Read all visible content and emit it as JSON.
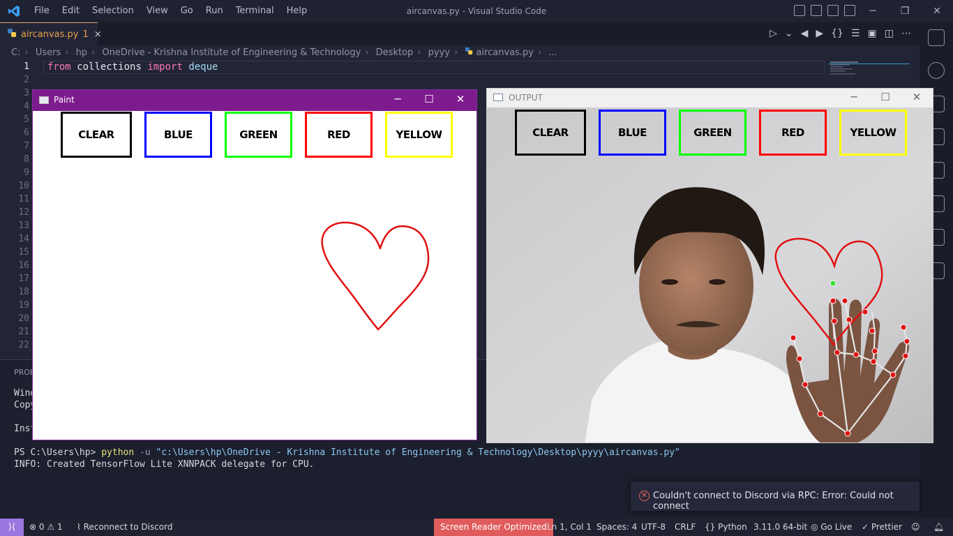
{
  "titlebar": {
    "menu": [
      "File",
      "Edit",
      "Selection",
      "View",
      "Go",
      "Run",
      "Terminal",
      "Help"
    ],
    "title": "aircanvas.py - Visual Studio Code"
  },
  "tab": {
    "filename": "aircanvas.py",
    "badge": "1",
    "close": "×"
  },
  "breadcrumb": [
    "C:",
    "Users",
    "hp",
    "OneDrive - Krishna Institute of Engineering & Technology",
    "Desktop",
    "pyyy",
    "aircanvas.py",
    "..."
  ],
  "editor": {
    "line_numbers": [
      "1",
      "2",
      "3",
      "4",
      "5",
      "6",
      "7",
      "8",
      "9",
      "10",
      "11",
      "12",
      "13",
      "14",
      "15",
      "16",
      "17",
      "18",
      "19",
      "20",
      "21",
      "22"
    ],
    "code_line1": {
      "kw1": "from",
      "mod": "collections",
      "kw2": "import",
      "name": "deque"
    }
  },
  "panel": {
    "title": "PROB",
    "partial_lines": [
      "Wind",
      "Copy",
      "",
      "Inst"
    ],
    "prompt": "PS C:\\Users\\hp>",
    "cmd": "python",
    "flag": "-u",
    "path": "\"c:\\Users\\hp\\OneDrive - Krishna Institute of Engineering & Technology\\Desktop\\pyyy\\aircanvas.py\"",
    "info": "INFO: Created TensorFlow Lite XNNPACK delegate for CPU."
  },
  "paint_window": {
    "title": "Paint",
    "buttons": [
      {
        "label": "CLEAR",
        "color": "#000000"
      },
      {
        "label": "BLUE",
        "color": "#0000ff"
      },
      {
        "label": "GREEN",
        "color": "#00ff00"
      },
      {
        "label": "RED",
        "color": "#ff0000"
      },
      {
        "label": "YELLOW",
        "color": "#ffff00"
      }
    ],
    "stroke_color": "#ff0000"
  },
  "output_window": {
    "title": "OUTPUT",
    "buttons": [
      {
        "label": "CLEAR",
        "color": "#000000"
      },
      {
        "label": "BLUE",
        "color": "#0000ff"
      },
      {
        "label": "GREEN",
        "color": "#00ff00"
      },
      {
        "label": "RED",
        "color": "#ff0000"
      },
      {
        "label": "YELLOW",
        "color": "#ffff00"
      }
    ]
  },
  "notification": {
    "message": "Couldn't connect to Discord via RPC: Error: Could not connect"
  },
  "statusbar": {
    "errors": "0",
    "warnings": "1",
    "discord": "Reconnect to Discord",
    "screen_reader": "Screen Reader Optimized",
    "position": "Ln 1, Col 1",
    "spaces": "Spaces: 4",
    "encoding": "UTF-8",
    "eol": "CRLF",
    "language": "Python",
    "interpreter": "3.11.0 64-bit",
    "golive": "Go Live",
    "prettier": "Prettier"
  }
}
